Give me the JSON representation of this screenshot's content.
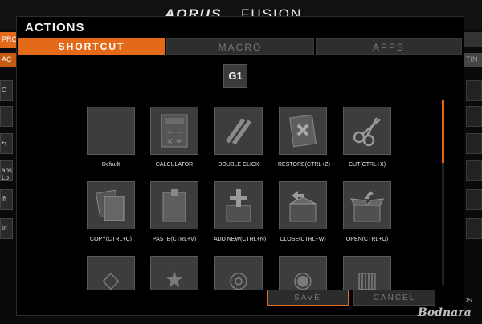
{
  "app": {
    "brand_left": "AORUS",
    "brand_right": "FUSION"
  },
  "background": {
    "left_tab1": "PRO",
    "left_tab2": "AC",
    "left_keys": [
      "C",
      "",
      "⇆",
      "aps Lo",
      "ift",
      "trl"
    ],
    "right_tab2": "TIN",
    "bottom_text": "OS"
  },
  "watermark": "Bodnara",
  "dialog": {
    "title": "ACTIONS",
    "tabs": {
      "shortcut": "SHORTCUT",
      "macro": "MACRO",
      "apps": "APPS"
    },
    "active_tab": "SHORTCUT",
    "selected_key": "G1",
    "items": [
      {
        "label": "Default",
        "icon": "blank-icon"
      },
      {
        "label": "CALCULATOR",
        "icon": "calculator-icon"
      },
      {
        "label": "DOUBLE CLICK",
        "icon": "double-click-icon"
      },
      {
        "label": "RESTORE(CTRL+Z)",
        "icon": "restore-icon"
      },
      {
        "label": "CUT(CTRL+X)",
        "icon": "scissors-icon"
      },
      {
        "label": "COPY(CTRL+C)",
        "icon": "copy-icon"
      },
      {
        "label": "PASTE(CTRL+V)",
        "icon": "paste-icon"
      },
      {
        "label": "ADD NEW(CTRL+N)",
        "icon": "add-new-icon"
      },
      {
        "label": "CLOSE(CTRL+W)",
        "icon": "close-box-icon"
      },
      {
        "label": "OPEN(CTRL+O)",
        "icon": "open-box-icon"
      },
      {
        "label": "",
        "icon": "partial-icon-1"
      },
      {
        "label": "",
        "icon": "partial-icon-2"
      },
      {
        "label": "",
        "icon": "partial-icon-3"
      },
      {
        "label": "",
        "icon": "partial-icon-4"
      },
      {
        "label": "",
        "icon": "partial-icon-5"
      }
    ],
    "buttons": {
      "save": "SAVE",
      "cancel": "CANCEL"
    },
    "accent_color": "#e46a1a"
  }
}
